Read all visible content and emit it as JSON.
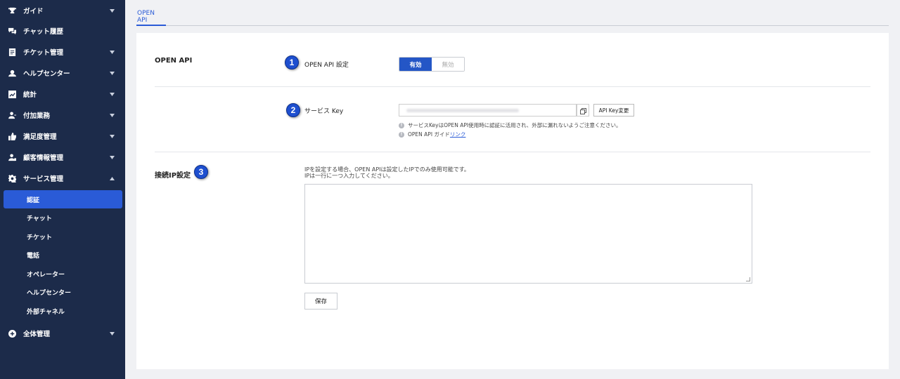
{
  "sidebar": {
    "items": [
      {
        "label": "ガイド",
        "icon": "trophy-icon"
      },
      {
        "label": "チャット履歴",
        "icon": "chat-icon"
      },
      {
        "label": "チケット管理",
        "icon": "document-icon"
      },
      {
        "label": "ヘルプセンター",
        "icon": "headset-icon"
      },
      {
        "label": "統計",
        "icon": "chart-icon"
      },
      {
        "label": "付加業務",
        "icon": "person-icon"
      },
      {
        "label": "満足度管理",
        "icon": "thumbs-up-icon"
      },
      {
        "label": "顧客情報管理",
        "icon": "person-card-icon"
      },
      {
        "label": "サービス管理",
        "icon": "gear-icon"
      },
      {
        "label": "全体管理",
        "icon": "plus-circle-icon"
      }
    ],
    "sub_items": [
      "認証",
      "チャット",
      "チケット",
      "電話",
      "オペレーター",
      "ヘルプセンター",
      "外部チャネル"
    ]
  },
  "tabs": {
    "active": "OPEN API"
  },
  "open_api": {
    "section_title": "OPEN API",
    "badge": "1",
    "setting_label": "OPEN API 設定",
    "toggle_on": "有効",
    "toggle_off": "無効"
  },
  "service_key": {
    "badge": "2",
    "label": "サービス Key",
    "change_button": "API Key変更",
    "note1": "サービスKeyはOPEN API使用時に認証に活用され、外部に漏れないようご注意ください。",
    "note2_prefix": "OPEN API ガイド",
    "note2_link": "リンク"
  },
  "ip": {
    "section_title": "接続IP設定",
    "badge": "3",
    "help1": "IPを設定する場合、OPEN APIは設定したIPでのみ使用可能です。",
    "help2": "IPは一行に一つ入力してください。",
    "value": "",
    "save_button": "保存"
  },
  "colors": {
    "sidebar_bg": "#1c2b4a",
    "accent": "#2a5bd7",
    "badge": "#1e4fcf"
  }
}
